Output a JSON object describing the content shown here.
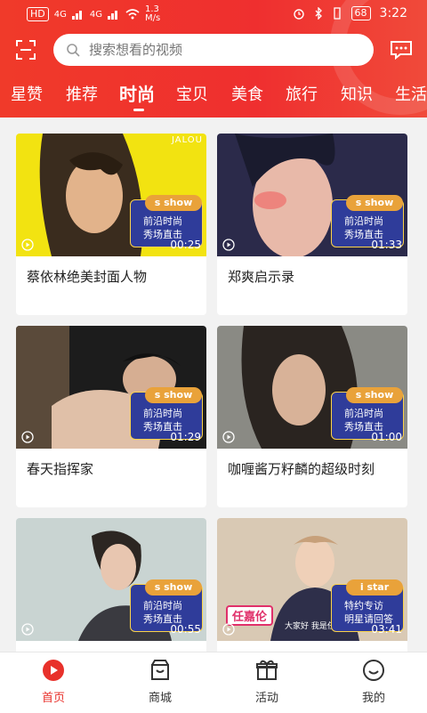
{
  "status": {
    "network": "1.3\nM/s",
    "net_left": "HD",
    "signal1": "4G",
    "signal2": "4G",
    "battery": "68",
    "time": "3:22"
  },
  "search": {
    "placeholder": "搜索想看的视频"
  },
  "tabs": [
    "星赞",
    "推荐",
    "时尚",
    "宝贝",
    "美食",
    "旅行",
    "知识",
    "生活"
  ],
  "active_tab_index": 2,
  "videos": [
    {
      "title": "蔡依林绝美封面人物",
      "badge_tag": "s show",
      "badge_line1": "前沿时尚",
      "badge_line2": "秀场直击",
      "duration": "00:25",
      "photo_corner_text": "JALOU"
    },
    {
      "title": "郑爽启示录",
      "badge_tag": "s show",
      "badge_line1": "前沿时尚",
      "badge_line2": "秀场直击",
      "duration": "01:33"
    },
    {
      "title": "春天指挥家",
      "badge_tag": "s show",
      "badge_line1": "前沿时尚",
      "badge_line2": "秀场直击",
      "duration": "01:29"
    },
    {
      "title": "咖喱酱万籽麟的超级时刻",
      "badge_tag": "s show",
      "badge_line1": "前沿时尚",
      "badge_line2": "秀场直击",
      "duration": "01:00"
    },
    {
      "title": "",
      "badge_tag": "s show",
      "badge_line1": "前沿时尚",
      "badge_line2": "秀场直击",
      "duration": "00:55"
    },
    {
      "title": "",
      "badge_tag": "i star",
      "badge_line1": "特约专访",
      "badge_line2": "明星请回答",
      "duration": "03:41",
      "name_tag": "任嘉伦",
      "subtitle": "大家好 我是任嘉"
    }
  ],
  "bottom_nav": [
    {
      "label": "首页",
      "icon": "play-circle-icon"
    },
    {
      "label": "商城",
      "icon": "shop-icon"
    },
    {
      "label": "活动",
      "icon": "gift-icon"
    },
    {
      "label": "我的",
      "icon": "smile-icon"
    }
  ],
  "colors": {
    "accent": "#ef2f2f",
    "badge_bg": "#2f3c9a",
    "badge_tag": "#e9a23a",
    "nav_active": "#e8312b"
  }
}
